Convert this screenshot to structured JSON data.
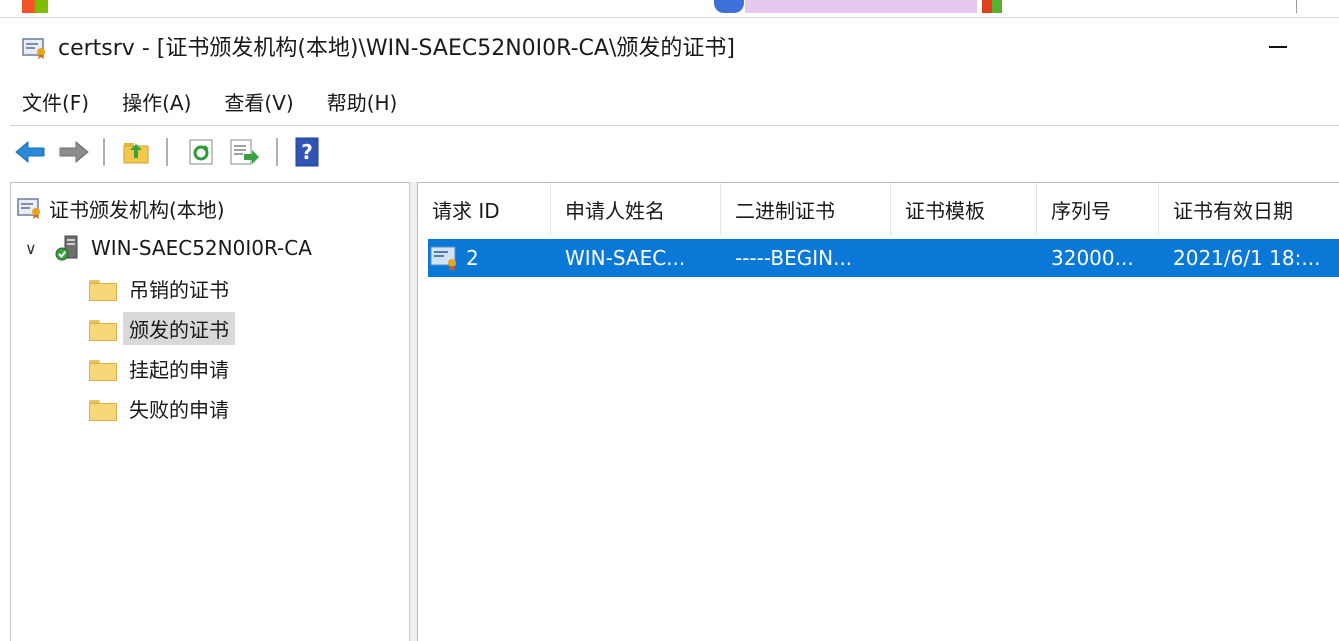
{
  "window": {
    "title": "certsrv - [证书颁发机构(本地)\\WIN-SAEC52N0I0R-CA\\颁发的证书]"
  },
  "menu": {
    "items": [
      "文件(F)",
      "操作(A)",
      "查看(V)",
      "帮助(H)"
    ]
  },
  "tree": {
    "root_label": "证书颁发机构(本地)",
    "ca_label": "WIN-SAEC52N0I0R-CA",
    "folders": [
      "吊销的证书",
      "颁发的证书",
      "挂起的申请",
      "失败的申请"
    ],
    "selected_folder": "颁发的证书"
  },
  "list": {
    "columns": [
      "请求 ID",
      "申请人姓名",
      "二进制证书",
      "证书模板",
      "序列号",
      "证书有效日期"
    ],
    "rows": [
      {
        "request_id": "2",
        "requester": "WIN-SAEC...",
        "binary": "-----BEGIN...",
        "template": "",
        "serial": "32000...",
        "valid_from": "2021/6/1 18:..."
      }
    ]
  },
  "colors": {
    "selection": "#0a78d7",
    "tree_selected": "#d9d9d9"
  },
  "icons": [
    "back-arrow-icon",
    "forward-arrow-icon",
    "up-folder-icon",
    "refresh-icon",
    "export-list-icon",
    "help-icon",
    "certificate-icon",
    "server-icon",
    "folder-icon"
  ]
}
